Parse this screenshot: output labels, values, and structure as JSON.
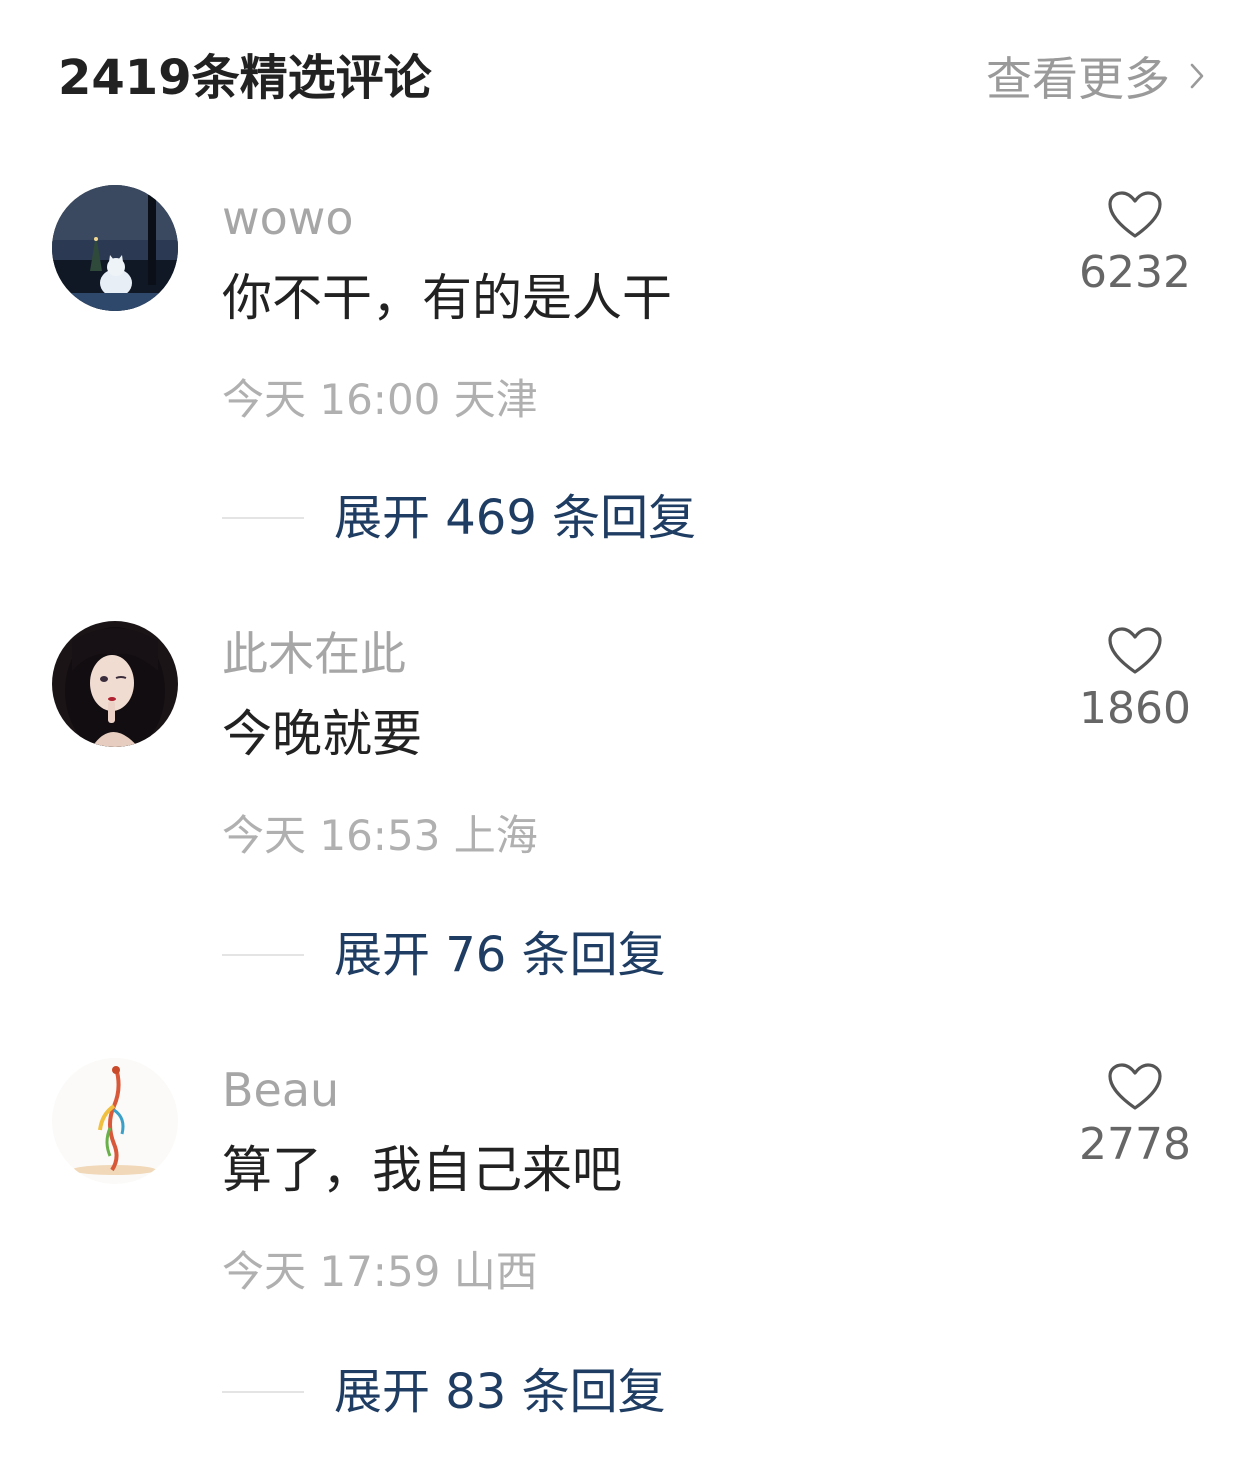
{
  "header": {
    "title": "2419条精选评论",
    "view_more": "查看更多"
  },
  "icons": {
    "view_more": "chevron-right-icon",
    "like": "heart-outline-icon"
  },
  "colors": {
    "link": "#1f3d63",
    "muted": "#a6a6a6",
    "text": "#222222"
  },
  "comments": [
    {
      "username": "wowo",
      "text": "你不干，有的是人干",
      "time": "今天 16:00 天津",
      "likes": "6232",
      "replies": "展开 469 条回复"
    },
    {
      "username": "此木在此",
      "text": "今晚就要",
      "time": "今天 16:53 上海",
      "likes": "1860",
      "replies": "展开 76 条回复"
    },
    {
      "username": "Beau",
      "text": "算了，我自己来吧",
      "time": "今天 17:59 山西",
      "likes": "2778",
      "replies": "展开 83 条回复"
    }
  ]
}
